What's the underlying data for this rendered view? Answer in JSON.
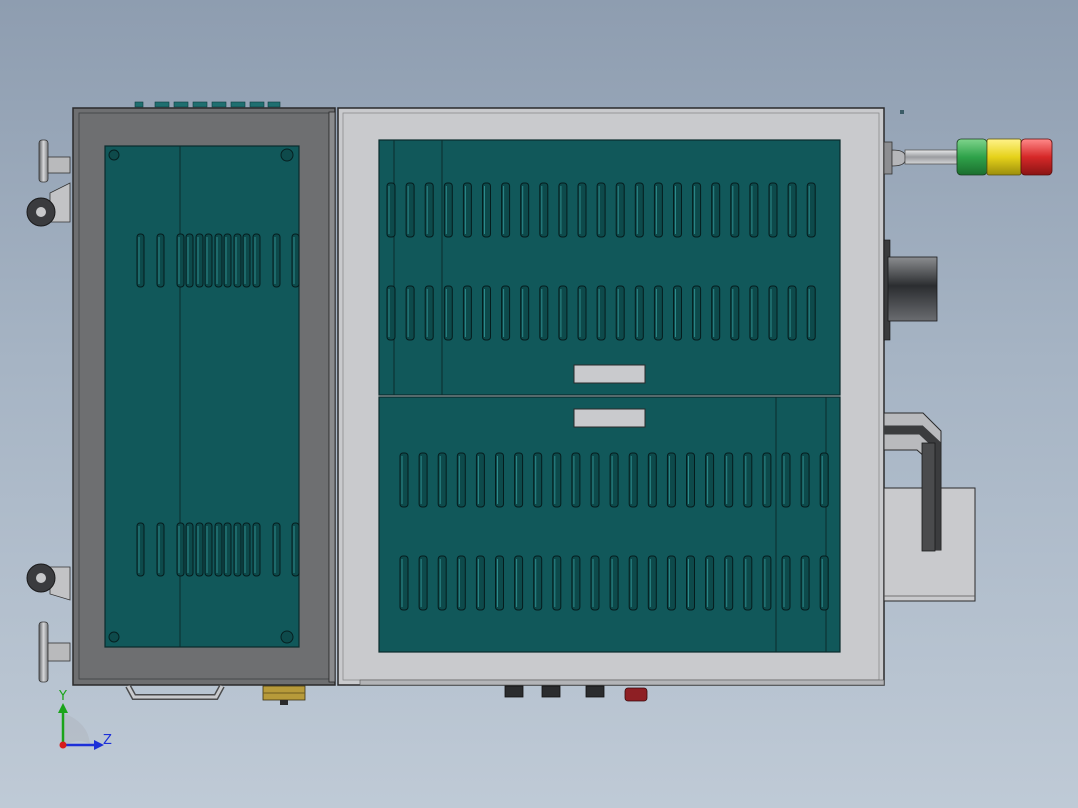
{
  "viewport": {
    "name": "cad-graphics-area",
    "background_top": "#8e9db0",
    "background_bottom": "#bfcad6"
  },
  "model": {
    "panel_color": "#11585a",
    "frame_color": "#6e6f71",
    "cabinet_color": "#c9cacd",
    "tower_light": [
      "#2fa24a",
      "#e6d21a",
      "#d62828"
    ]
  },
  "triad": {
    "x_label": "",
    "y_label": "Y",
    "z_label": "Z"
  }
}
